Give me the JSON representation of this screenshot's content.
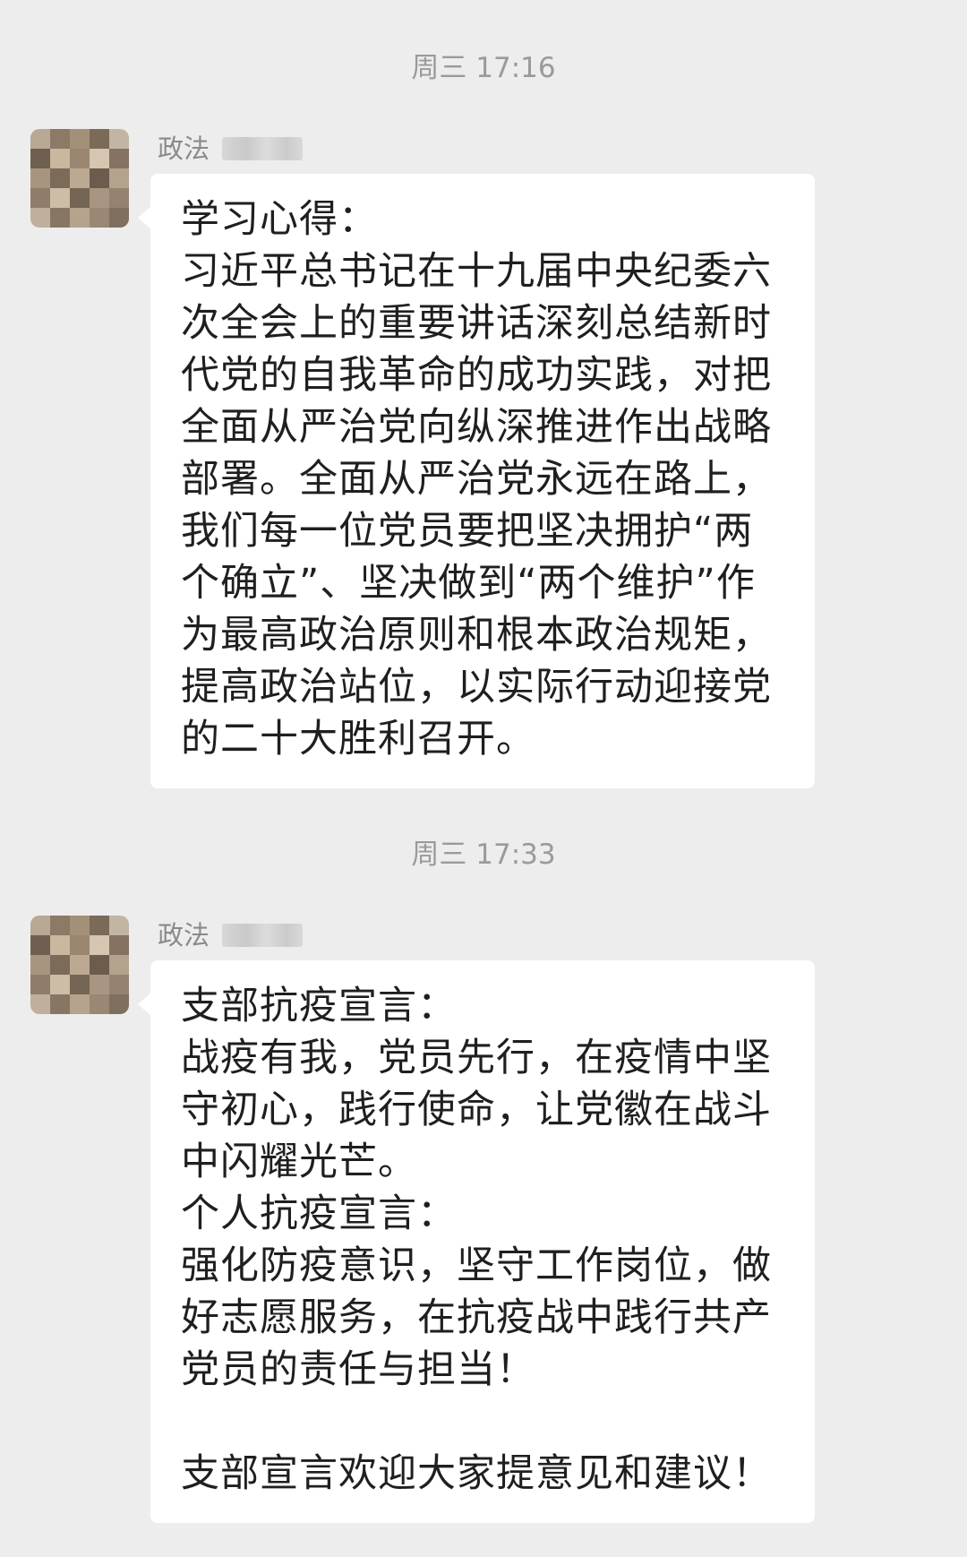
{
  "messages": [
    {
      "time": "周三 17:16",
      "sender": "政法",
      "lines": [
        "学习心得：",
        "习近平总书记在十九届中央纪委六",
        "次全会上的重要讲话深刻总结新时",
        "代党的自我革命的成功实践，对把",
        "全面从严治党向纵深推进作出战略",
        "部署。全面从严治党永远在路上，",
        "我们每一位党员要把坚决拥护“两",
        "个确立”、坚决做到“两个维护”作",
        "为最高政治原则和根本政治规矩，",
        "提高政治站位，以实际行动迎接党",
        "的二十大胜利召开。"
      ]
    },
    {
      "time": "周三 17:33",
      "sender": "政法",
      "lines": [
        "支部抗疫宣言：",
        "战疫有我，党员先行，在疫情中坚",
        "守初心，践行使命，让党徽在战斗",
        "中闪耀光芒。",
        "个人抗疫宣言：",
        "强化防疫意识，坚守工作岗位，做",
        "好志愿服务，在抗疫战中践行共产",
        "党员的责任与担当！",
        "",
        "支部宣言欢迎大家提意见和建议！"
      ]
    }
  ],
  "colors": {
    "background": "#ededed",
    "bubble": "#ffffff",
    "text": "#1f1f1f",
    "timestamp": "#9a9a9a",
    "sender": "#8a8a8a"
  }
}
